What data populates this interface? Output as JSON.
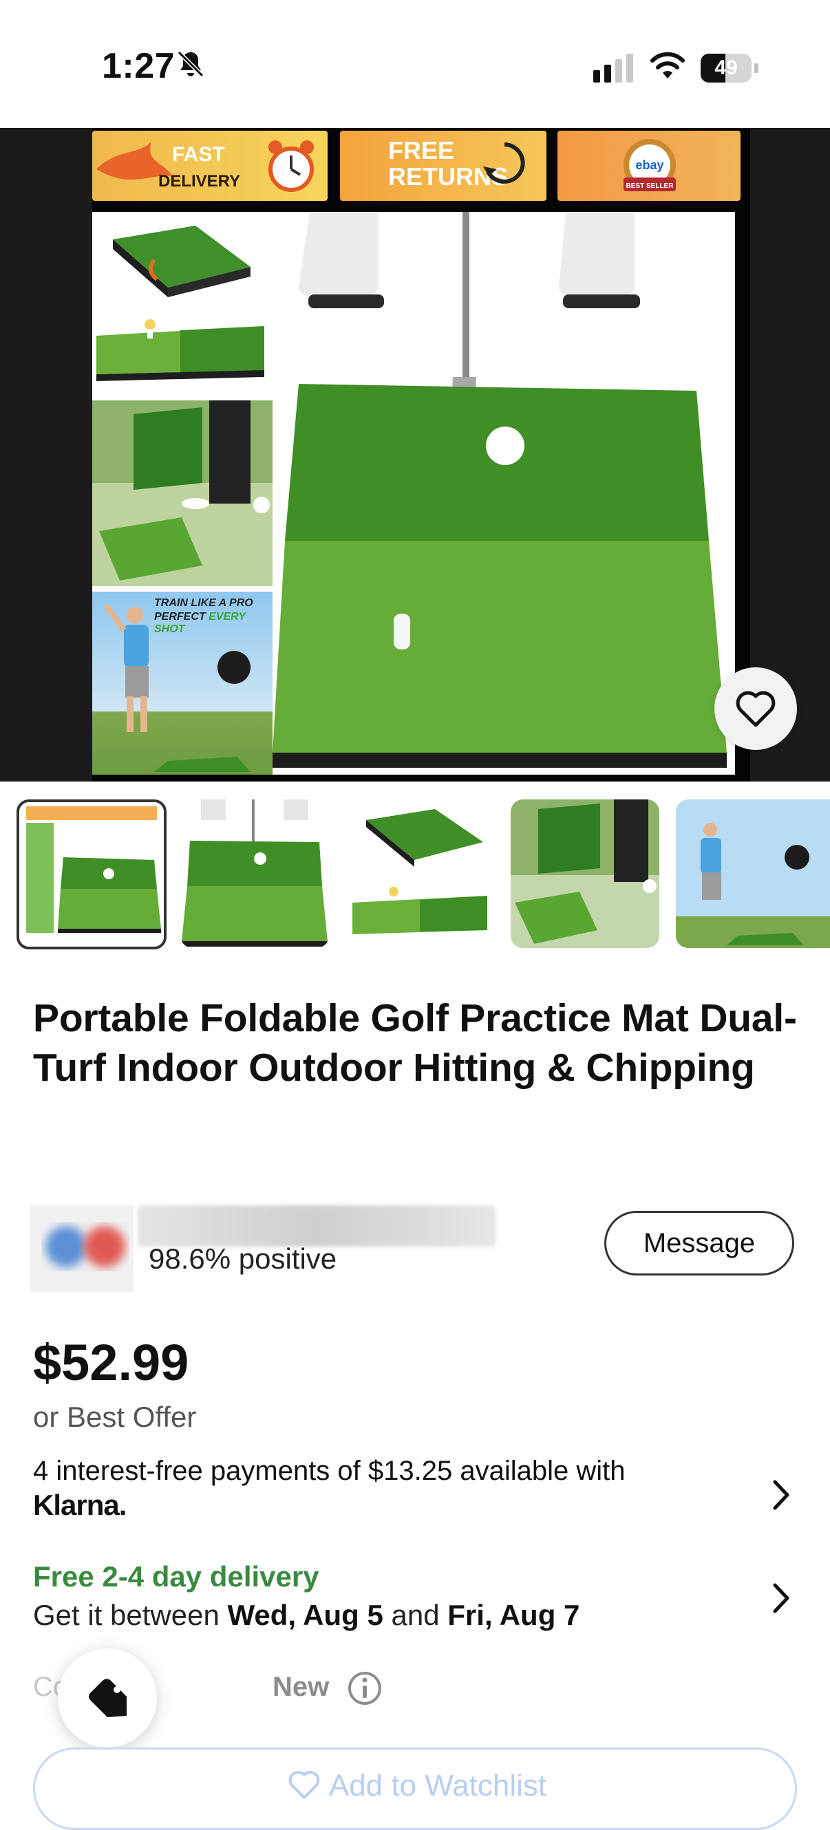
{
  "status_bar": {
    "time": "1:27",
    "battery_level": "49",
    "battery_fraction": 0.49,
    "icons": [
      "bell-slash-icon",
      "cellular-signal-icon",
      "wifi-icon",
      "battery-icon"
    ]
  },
  "hero": {
    "banners": {
      "fast_line1": "FAST",
      "fast_line2": "DELIVERY",
      "returns_line1": "FREE",
      "returns_line2": "RETURNS",
      "seal_brand": "ebay",
      "seal_ribbon": "BEST SELLER"
    },
    "tile_text": {
      "train_line1": "TRAIN LIKE A PRO",
      "train_line2_a": "PERFECT ",
      "train_line2_b": "EVERY SHOT"
    }
  },
  "thumbnails": [
    {
      "label": "thumbnail-1",
      "active": true
    },
    {
      "label": "thumbnail-2",
      "active": false
    },
    {
      "label": "thumbnail-3",
      "active": false
    },
    {
      "label": "thumbnail-4",
      "active": false
    },
    {
      "label": "thumbnail-5",
      "active": false
    }
  ],
  "product": {
    "title": "Portable Foldable Golf Practice Mat Dual-Turf Indoor Outdoor Hitting & Chipping",
    "price": "$52.99",
    "best_offer": "or Best Offer"
  },
  "seller": {
    "feedback": "98.6% positive",
    "message_label": "Message"
  },
  "klarna": {
    "text": "4 interest-free payments of $13.25 available with",
    "logo": "Klarna."
  },
  "delivery": {
    "title": "Free 2-4 day delivery",
    "prefix": "Get it between ",
    "start": "Wed, Aug 5",
    "middle": " and ",
    "end": "Fri, Aug 7"
  },
  "condition": {
    "label": "Condition",
    "value": "New"
  },
  "watchlist": {
    "label": "Add to Watchlist"
  },
  "colors": {
    "delivery_green": "#3a8a3e",
    "watch_border": "#c9d8f2",
    "turf_green": "#4f9a2c"
  }
}
